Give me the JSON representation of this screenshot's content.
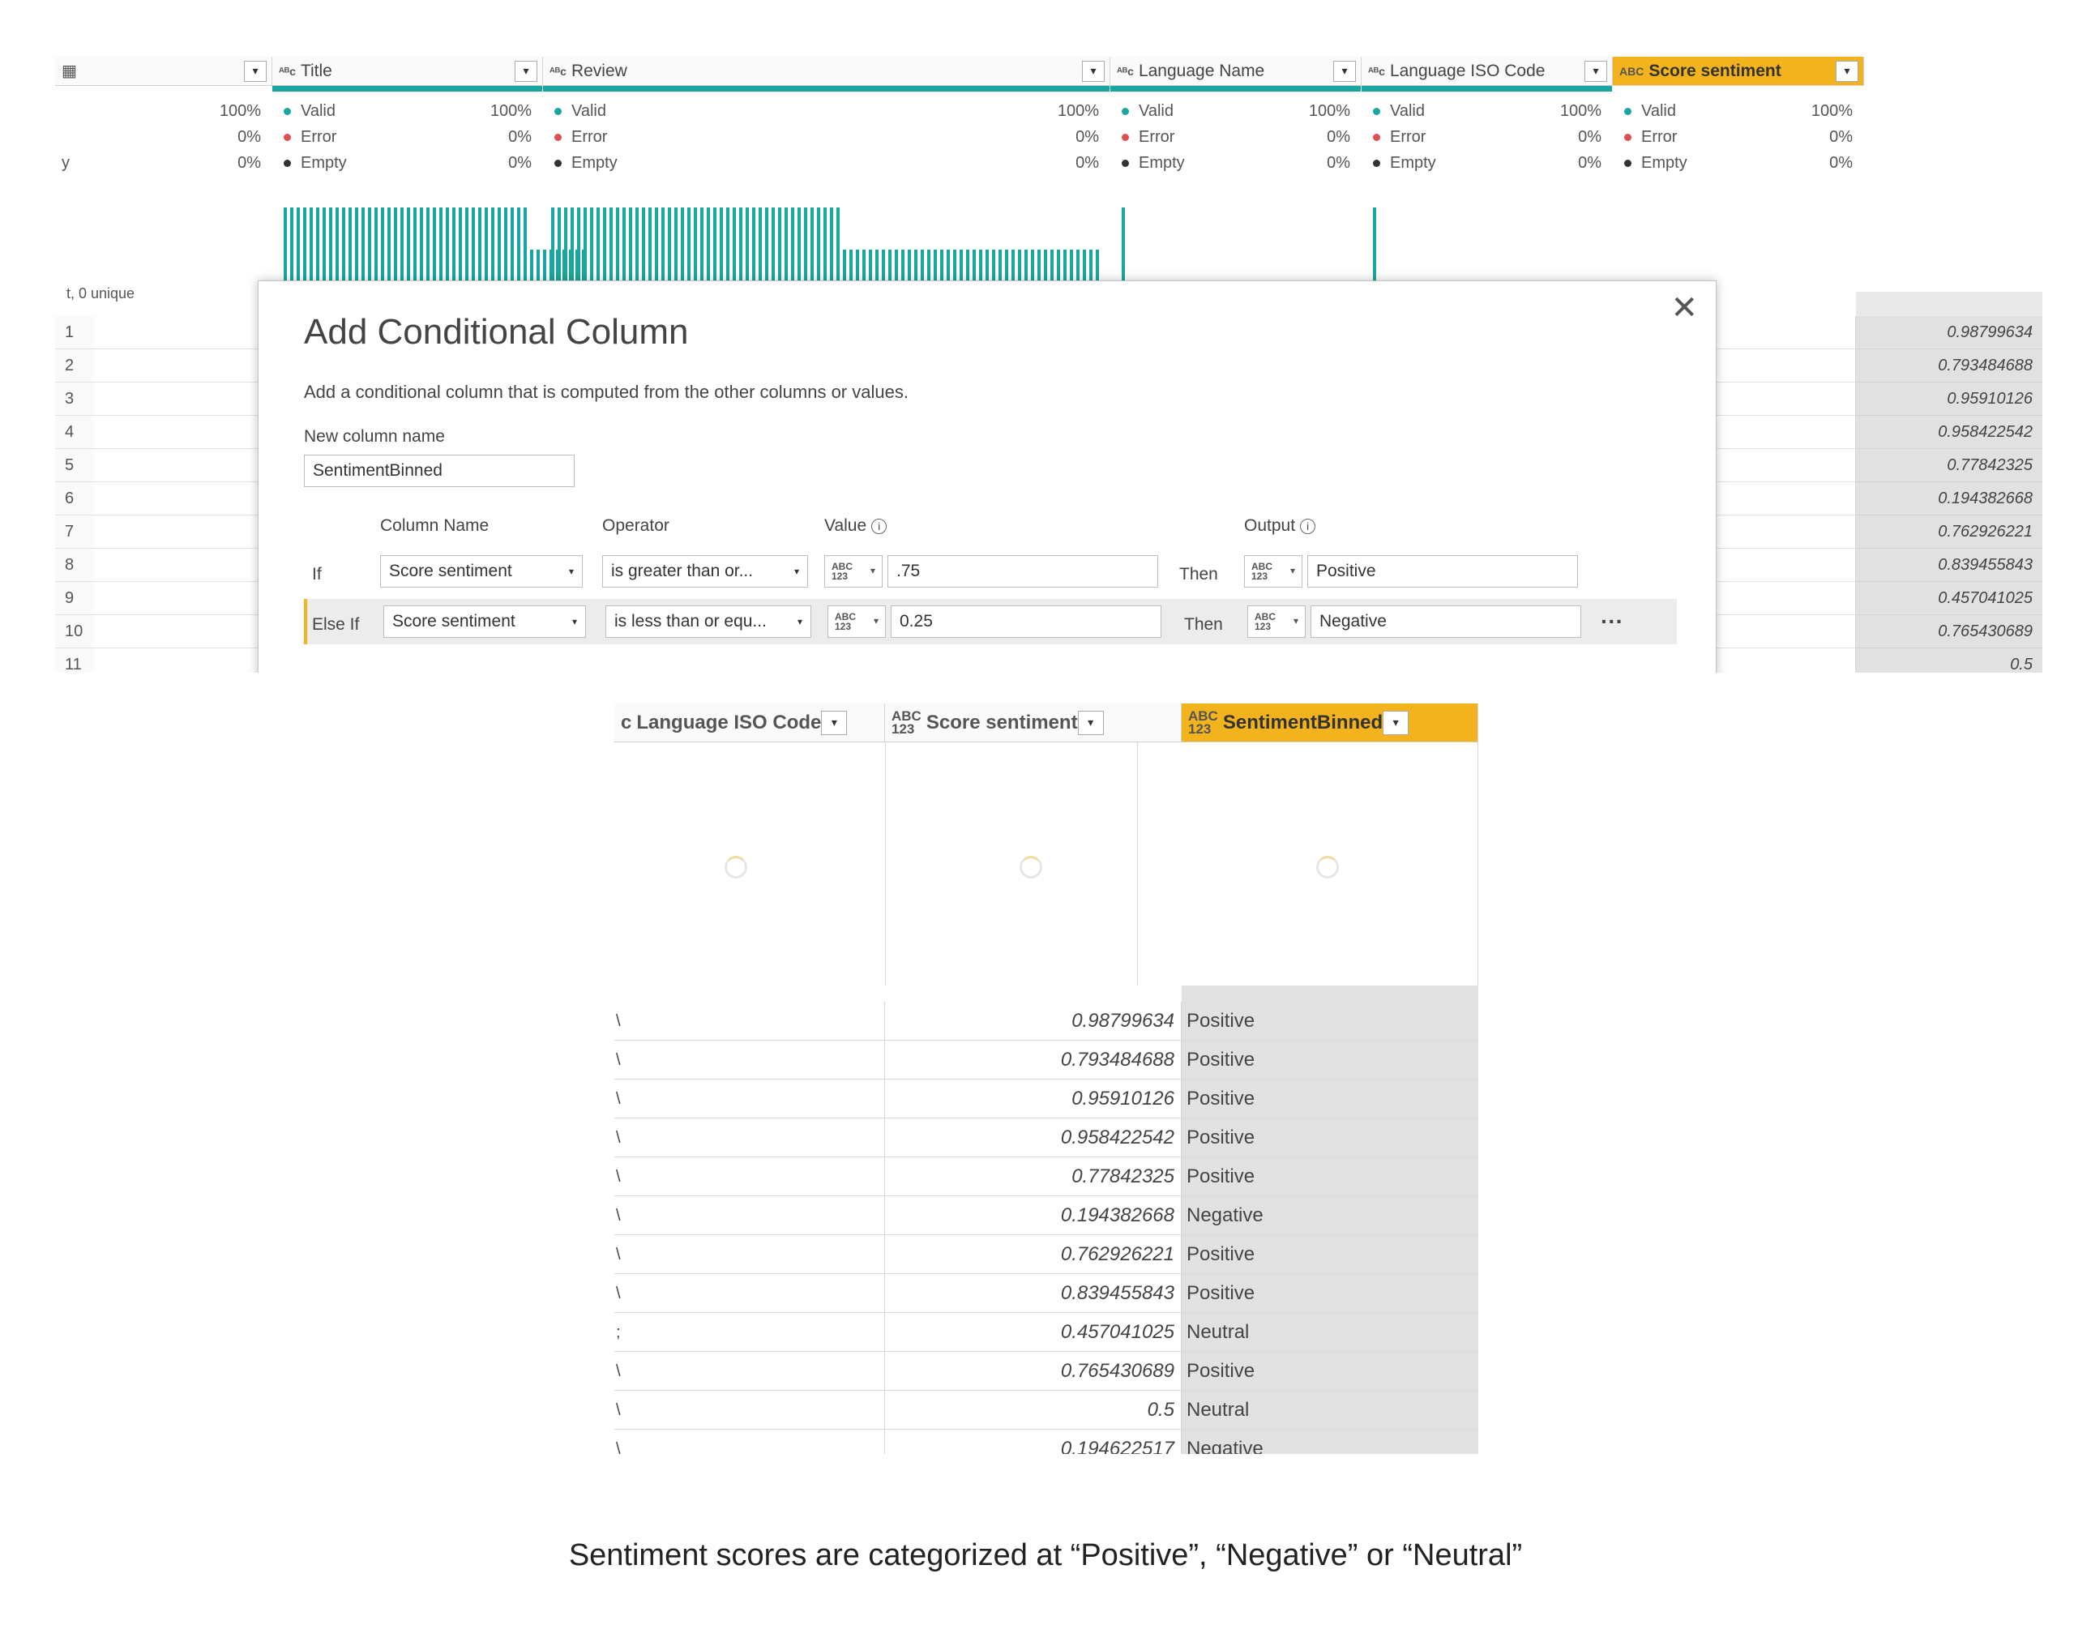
{
  "top": {
    "columns": [
      {
        "label": "",
        "type": "table-icon",
        "selected": false
      },
      {
        "label": "Title",
        "type": "ABC",
        "selected": false
      },
      {
        "label": "Review",
        "type": "ABC",
        "selected": false
      },
      {
        "label": "Language Name",
        "type": "ABC",
        "selected": false
      },
      {
        "label": "Language ISO Code",
        "type": "ABC",
        "selected": false
      },
      {
        "label": "Score sentiment",
        "type": "ABC123",
        "selected": true
      }
    ],
    "quality": [
      {
        "valid_label": "",
        "valid": "100%",
        "error_label": "",
        "error": "0%",
        "empty_label": "y",
        "empty": "0%"
      },
      {
        "valid_label": "Valid",
        "valid": "100%",
        "error_label": "Error",
        "error": "0%",
        "empty_label": "Empty",
        "empty": "0%"
      },
      {
        "valid_label": "Valid",
        "valid": "100%",
        "error_label": "Error",
        "error": "0%",
        "empty_label": "Empty",
        "empty": "0%"
      },
      {
        "valid_label": "Valid",
        "valid": "100%",
        "error_label": "Error",
        "error": "0%",
        "empty_label": "Empty",
        "empty": "0%"
      },
      {
        "valid_label": "Valid",
        "valid": "100%",
        "error_label": "Error",
        "error": "0%",
        "empty_label": "Empty",
        "empty": "0%"
      },
      {
        "valid_label": "Valid",
        "valid": "100%",
        "error_label": "Error",
        "error": "0%",
        "empty_label": "Empty",
        "empty": "0%"
      }
    ],
    "distinct_note": "t, 0 unique",
    "row_numbers": [
      "1",
      "2",
      "3",
      "4",
      "5",
      "6",
      "7",
      "8",
      "9",
      "10",
      "11"
    ],
    "scores": [
      "0.98799634",
      "0.793484688",
      "0.95910126",
      "0.958422542",
      "0.77842325",
      "0.194382668",
      "0.762926221",
      "0.839455843",
      "0.457041025",
      "0.765430689",
      "0.5"
    ],
    "dialog": {
      "title": "Add Conditional Column",
      "description": "Add a conditional column that is computed from the other columns or values.",
      "new_column_label": "New column name",
      "new_column_value": "SentimentBinned",
      "col_name_header": "Column Name",
      "operator_header": "Operator",
      "value_header": "Value",
      "output_header": "Output",
      "type_label": "ABC\n123",
      "rules": [
        {
          "keyword": "If",
          "column": "Score sentiment",
          "operator": "is greater than or...",
          "value": ".75",
          "then": "Then",
          "output": "Positive"
        },
        {
          "keyword": "Else If",
          "column": "Score sentiment",
          "operator": "is less than or equ...",
          "value": "0.25",
          "then": "Then",
          "output": "Negative"
        }
      ],
      "more": "···",
      "close": "✕",
      "info": "i"
    }
  },
  "bottom": {
    "headers": [
      {
        "label": "Language ISO Code",
        "prefix": "c",
        "type": "",
        "selected": false
      },
      {
        "label": "Score sentiment",
        "type": "ABC\n123",
        "selected": false
      },
      {
        "label": "SentimentBinned",
        "type": "ABC\n123",
        "selected": true
      }
    ],
    "codes": [
      "\\",
      "\\",
      "\\",
      "\\",
      "\\",
      "\\",
      "\\",
      "\\",
      ";",
      "\\",
      "\\",
      "\\"
    ],
    "rows": [
      {
        "score": "0.98799634",
        "bin": "Positive"
      },
      {
        "score": "0.793484688",
        "bin": "Positive"
      },
      {
        "score": "0.95910126",
        "bin": "Positive"
      },
      {
        "score": "0.958422542",
        "bin": "Positive"
      },
      {
        "score": "0.77842325",
        "bin": "Positive"
      },
      {
        "score": "0.194382668",
        "bin": "Negative"
      },
      {
        "score": "0.762926221",
        "bin": "Positive"
      },
      {
        "score": "0.839455843",
        "bin": "Positive"
      },
      {
        "score": "0.457041025",
        "bin": "Neutral"
      },
      {
        "score": "0.765430689",
        "bin": "Positive"
      },
      {
        "score": "0.5",
        "bin": "Neutral"
      },
      {
        "score": "0.194622517",
        "bin": "Negative"
      }
    ]
  },
  "caption": "Sentiment scores are categorized at “Positive”, “Negative” or “Neutral”",
  "colors": {
    "teal": "#1aa6a0",
    "selected_header": "#f2b31c",
    "valid_dot": "#1aa6a0",
    "error_dot": "#e04f4f",
    "empty_dot": "#333333"
  }
}
